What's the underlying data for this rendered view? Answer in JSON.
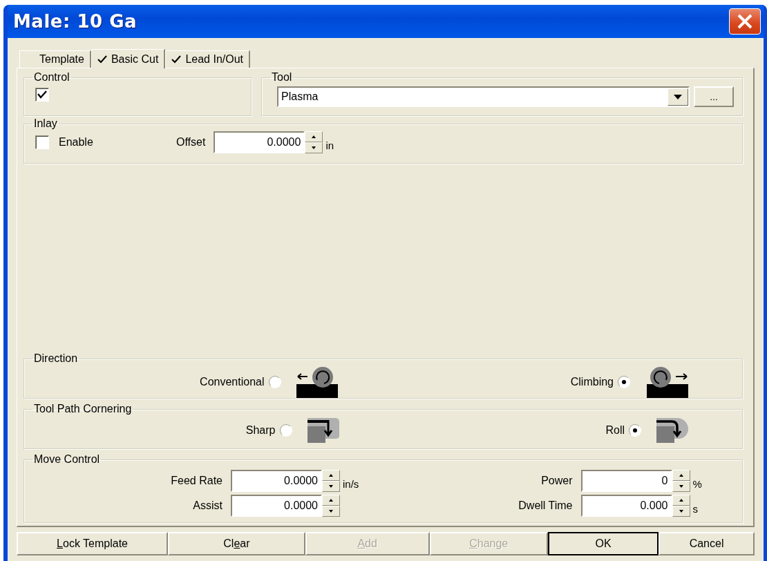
{
  "window": {
    "title": "Male: 10 Ga"
  },
  "tabs": [
    {
      "label": "Template",
      "checked": false,
      "selected": false
    },
    {
      "label": "Basic Cut",
      "checked": true,
      "selected": true
    },
    {
      "label": "Lead In/Out",
      "checked": true,
      "selected": false
    }
  ],
  "control": {
    "title": "Control",
    "checked": true
  },
  "tool": {
    "title": "Tool",
    "value": "Plasma",
    "browse_label": "..."
  },
  "inlay": {
    "title": "Inlay",
    "enable_label": "Enable",
    "enabled": false,
    "offset_label": "Offset",
    "offset_value": "0.0000",
    "offset_unit": "in"
  },
  "direction": {
    "title": "Direction",
    "options": [
      {
        "label": "Conventional",
        "selected": false,
        "kind": "conventional"
      },
      {
        "label": "Climbing",
        "selected": true,
        "kind": "climbing"
      }
    ]
  },
  "cornering": {
    "title": "Tool Path Cornering",
    "options": [
      {
        "label": "Sharp",
        "selected": false,
        "kind": "sharp"
      },
      {
        "label": "Roll",
        "selected": true,
        "kind": "roll"
      }
    ]
  },
  "move_control": {
    "title": "Move Control",
    "fields": [
      {
        "label": "Feed Rate",
        "value": "0.0000",
        "unit": "in/s"
      },
      {
        "label": "Power",
        "value": "0",
        "unit": "%"
      },
      {
        "label": "Assist",
        "value": "0.0000"
      },
      {
        "label": "Dwell Time",
        "value": "0.000",
        "unit": "s"
      }
    ]
  },
  "buttons": [
    {
      "access_key": "L",
      "label_rest": "ock Template",
      "disabled": false,
      "default": false
    },
    {
      "label": "Cl",
      "access_key": "e",
      "label_rest": "ar",
      "disabled": false,
      "default": false
    },
    {
      "access_key": "A",
      "label_rest": "dd",
      "disabled": true,
      "default": false
    },
    {
      "access_key": "C",
      "label_rest": "hange",
      "disabled": true,
      "default": false
    },
    {
      "label": "OK",
      "disabled": false,
      "default": true
    },
    {
      "label": "Cancel",
      "disabled": false,
      "default": false
    }
  ]
}
